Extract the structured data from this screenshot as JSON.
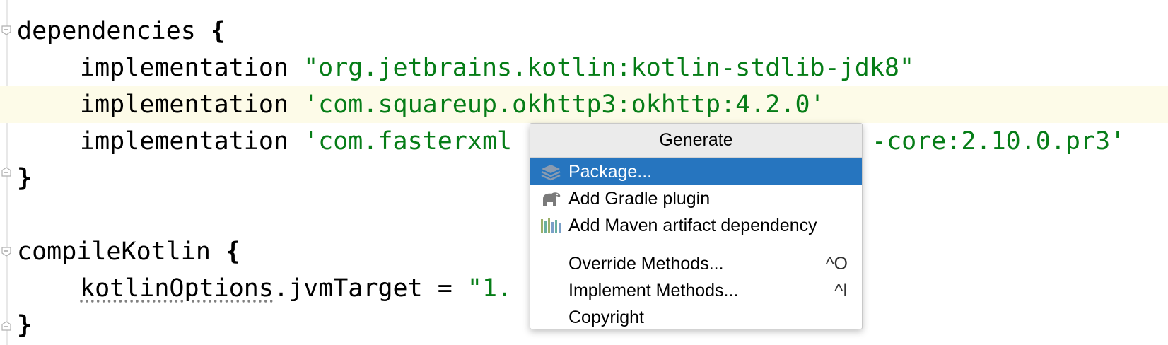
{
  "editor": {
    "lines": {
      "l1_kw": "dependencies",
      "l1_brace": "{",
      "l2_kw": "implementation",
      "l2_str": "\"org.jetbrains.kotlin:kotlin-stdlib-jdk8\"",
      "l3_kw": "implementation",
      "l3_str": "'com.squareup.okhttp3:okhttp:4.2.0'",
      "l4_kw": "implementation",
      "l4_str_left": "'com.fasterxml",
      "l4_str_right": "-core:2.10.0.pr3'",
      "l5_brace": "}",
      "l7_kw": "compileKotlin",
      "l7_brace": "{",
      "l8_prop": "kotlinOptions",
      "l8_rest": ".jvmTarget = ",
      "l8_str": "\"1.",
      "l9_brace": "}"
    },
    "colors": {
      "string": "#067d17",
      "caret_row": "#fdfbe8"
    }
  },
  "popup": {
    "title": "Generate",
    "items": [
      {
        "label": "Package...",
        "icon": "package-icon",
        "shortcut": "",
        "selected": true
      },
      {
        "label": "Add Gradle plugin",
        "icon": "gradle-elephant-icon",
        "shortcut": ""
      },
      {
        "label": "Add Maven artifact dependency",
        "icon": "maven-library-icon",
        "shortcut": ""
      },
      {
        "label": "Override Methods...",
        "icon": "",
        "shortcut": "^O"
      },
      {
        "label": "Implement Methods...",
        "icon": "",
        "shortcut": "^I"
      },
      {
        "label": "Copyright",
        "icon": "",
        "shortcut": ""
      }
    ],
    "colors": {
      "selection": "#2675bf"
    }
  }
}
